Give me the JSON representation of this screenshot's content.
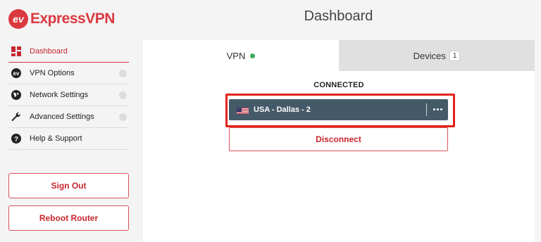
{
  "brand": {
    "name": "ExpressVPN",
    "mark": "ev",
    "color": "#da3940"
  },
  "header": {
    "title": "Dashboard"
  },
  "sidebar": {
    "items": [
      {
        "label": "Dashboard",
        "icon": "dashboard-grid-icon",
        "active": true
      },
      {
        "label": "VPN Options",
        "icon": "vpn-logo-icon",
        "active": false
      },
      {
        "label": "Network Settings",
        "icon": "globe-icon",
        "active": false
      },
      {
        "label": "Advanced Settings",
        "icon": "wrench-icon",
        "active": false
      },
      {
        "label": "Help & Support",
        "icon": "question-icon",
        "active": false
      }
    ],
    "sign_out_label": "Sign Out",
    "reboot_label": "Reboot Router"
  },
  "main": {
    "tabs": [
      {
        "label": "VPN",
        "status": "connected",
        "status_color": "#3dab5a"
      },
      {
        "label": "Devices",
        "count": "1"
      }
    ],
    "status_text": "CONNECTED",
    "location": {
      "label": "USA - Dallas - 2",
      "flag": "us-flag-icon",
      "bar_color": "#455a68"
    },
    "disconnect_label": "Disconnect",
    "highlight_color": "#e3241b"
  }
}
